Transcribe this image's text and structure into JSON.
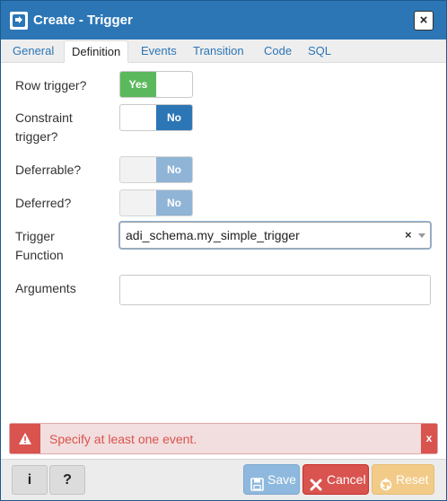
{
  "window": {
    "title": "Create - Trigger",
    "close_label": "×"
  },
  "tabs": [
    {
      "label": "General",
      "active": false
    },
    {
      "label": "Definition",
      "active": true
    },
    {
      "label": "Events",
      "active": false
    },
    {
      "label": "Transition",
      "active": false
    },
    {
      "label": "Code",
      "active": false
    },
    {
      "label": "SQL",
      "active": false
    }
  ],
  "form": {
    "row_trigger": {
      "label": "Row trigger?",
      "value": "Yes"
    },
    "constraint_trigger": {
      "label_line1": "Constraint",
      "label_line2": "trigger?",
      "value": "No"
    },
    "deferrable": {
      "label": "Deferrable?",
      "value": "No",
      "disabled": true
    },
    "deferred": {
      "label": "Deferred?",
      "value": "No",
      "disabled": true
    },
    "trigger_function": {
      "label_line1": "Trigger",
      "label_line2": "Function",
      "value": "adi_schema.my_simple_trigger",
      "clear_label": "×"
    },
    "arguments": {
      "label": "Arguments",
      "value": "",
      "placeholder": ""
    }
  },
  "error": {
    "message": "Specify at least one event.",
    "close_label": "x"
  },
  "footer": {
    "info_label": "i",
    "help_label": "?",
    "save_label": "Save",
    "cancel_label": "Cancel",
    "reset_label": "Reset"
  },
  "colors": {
    "titlebar": "#2c76b6",
    "yes_on": "#5cb85c",
    "no_on": "#2c76b6",
    "error": "#d9534f",
    "reset": "#f2cb88"
  }
}
